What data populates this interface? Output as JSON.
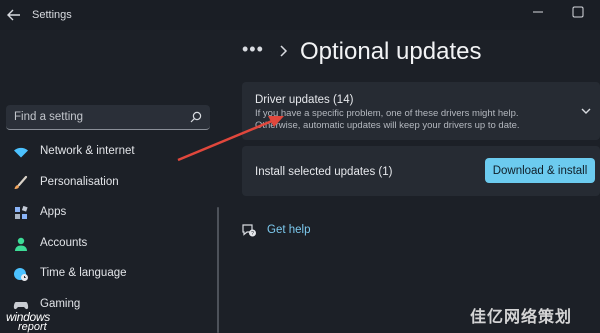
{
  "window": {
    "title": "Settings",
    "back_icon": "back-arrow-icon",
    "minimize_icon": "minimize-icon",
    "maximize_icon": "maximize-icon"
  },
  "search": {
    "placeholder": "Find a setting",
    "icon": "search-icon"
  },
  "sidebar": {
    "items": [
      {
        "label": "Network & internet",
        "icon": "wifi-icon",
        "color": "#4cc2ff"
      },
      {
        "label": "Personalisation",
        "icon": "brush-icon",
        "color": "#f0a35c"
      },
      {
        "label": "Apps",
        "icon": "apps-icon",
        "color": "#8ab4f8"
      },
      {
        "label": "Accounts",
        "icon": "person-icon",
        "color": "#3ddc97"
      },
      {
        "label": "Time & language",
        "icon": "globe-clock-icon",
        "color": "#4cc2ff"
      },
      {
        "label": "Gaming",
        "icon": "controller-icon",
        "color": "#c9ccd2"
      }
    ]
  },
  "header": {
    "breadcrumb_overflow": "•••",
    "title": "Optional updates"
  },
  "driver_card": {
    "title": "Driver updates (14)",
    "description": "If you have a specific problem, one of these drivers might help. Otherwise, automatic updates will keep your drivers up to date.",
    "expand_icon": "chevron-down-icon"
  },
  "install_card": {
    "label": "Install selected updates (1)",
    "button_label": "Download & install"
  },
  "help": {
    "label": "Get help",
    "icon": "help-chat-icon"
  },
  "watermarks": {
    "left_line1": "windows",
    "left_line2": "report",
    "right": "佳亿网络策划"
  },
  "colors": {
    "background": "#1c2027",
    "card": "#262b33",
    "accent": "#6ccbef",
    "link": "#7cc9ee",
    "annotation_arrow": "#e0473c"
  }
}
